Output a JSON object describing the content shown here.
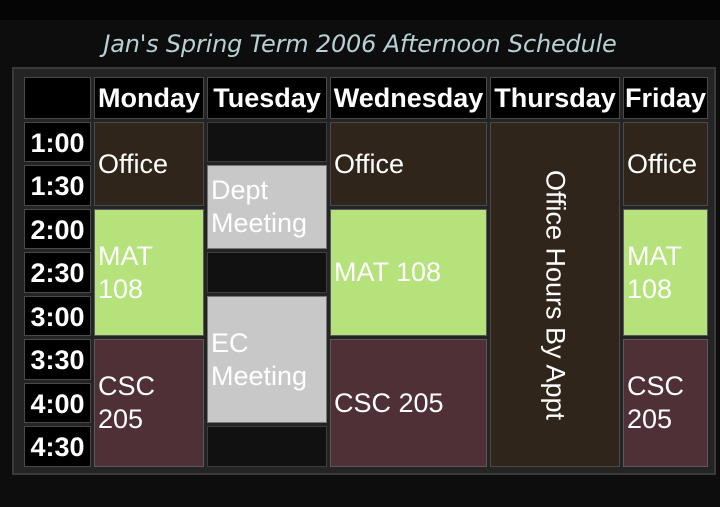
{
  "title": "Jan's Spring Term 2006 Afternoon Schedule",
  "days": [
    "Monday",
    "Tuesday",
    "Wednesday",
    "Thursday",
    "Friday"
  ],
  "times": [
    "1:00",
    "1:30",
    "2:00",
    "2:30",
    "3:00",
    "3:30",
    "4:00",
    "4:30"
  ],
  "events": {
    "office": "Office",
    "mat_wrapped": "MAT 108",
    "mat_line1": "MAT",
    "mat_line2": "108",
    "csc_line1": "CSC",
    "csc_line2": "205",
    "csc_full": "CSC 205",
    "dept_line1": "Dept",
    "dept_line2": "Meeting",
    "ec_line1": "EC",
    "ec_line2": "Meeting",
    "office_hours": "Office Hours By Appt"
  },
  "colors": {
    "office": "#30251b",
    "mat": "#b5e27a",
    "csc": "#4f3036",
    "meeting": "#c8c8c8",
    "title": "#b7d0d3"
  }
}
